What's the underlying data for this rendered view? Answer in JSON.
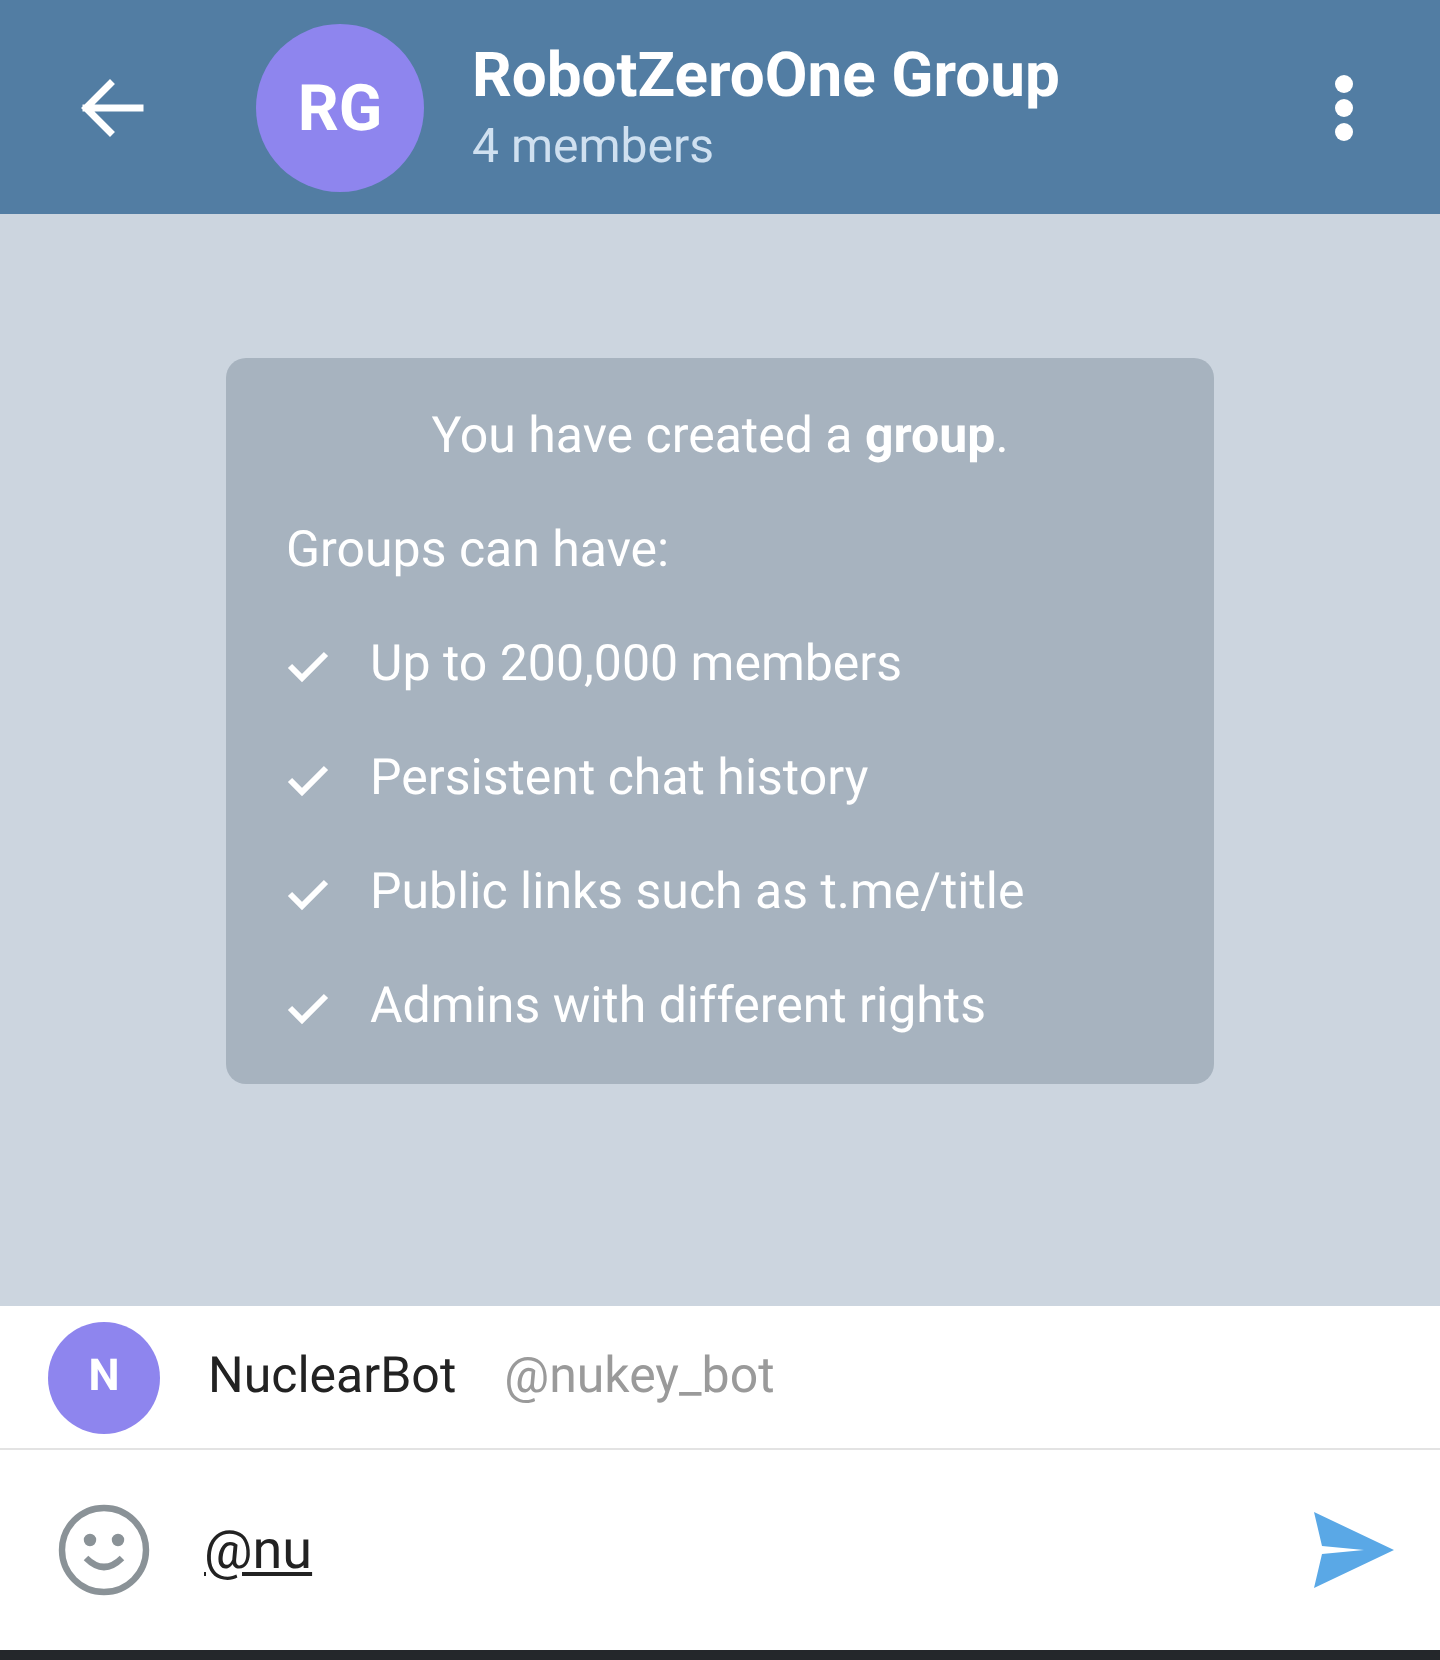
{
  "header": {
    "avatar_initials": "RG",
    "title": "RobotZeroOne Group",
    "subtitle": "4 members"
  },
  "service_message": {
    "title": "You have created a **group**.",
    "subtitle": "Groups can have:",
    "features": [
      {
        "text": "Up to 200,000 members",
        "checked": true
      },
      {
        "text": "Persistent chat history",
        "checked": true
      },
      {
        "text": "Public links such as t.me/title",
        "checked": true
      },
      {
        "text": "Admins with different rights",
        "checked": true
      }
    ]
  },
  "mention_suggestions": [
    {
      "avatar_initial": "N",
      "name": "NuclearBot",
      "username": "@nukey_bot"
    }
  ],
  "composer": {
    "value": "@nu"
  }
}
